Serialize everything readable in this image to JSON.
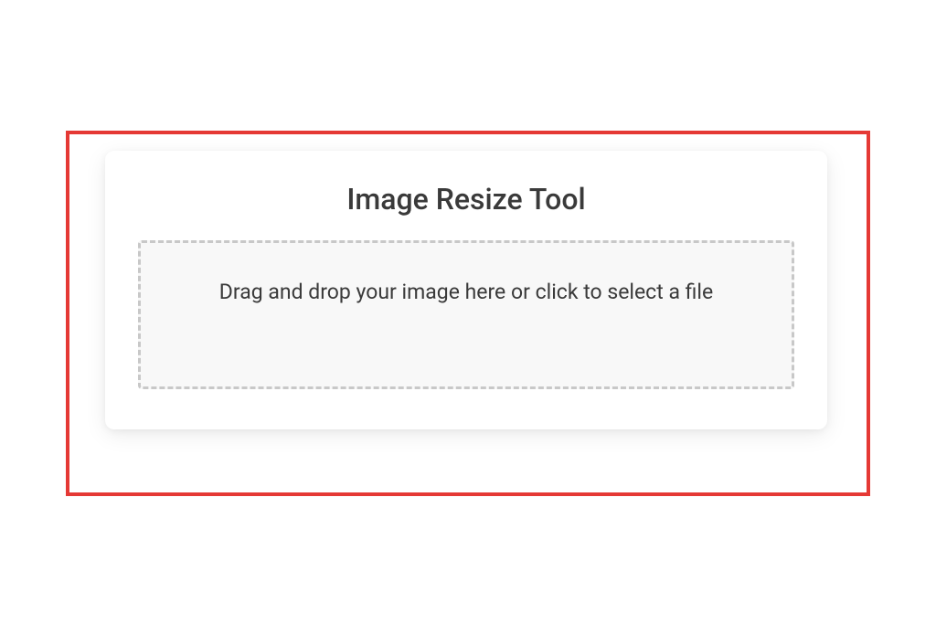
{
  "card": {
    "title": "Image Resize Tool",
    "dropzone_text": "Drag and drop your image here or click to select a file"
  }
}
